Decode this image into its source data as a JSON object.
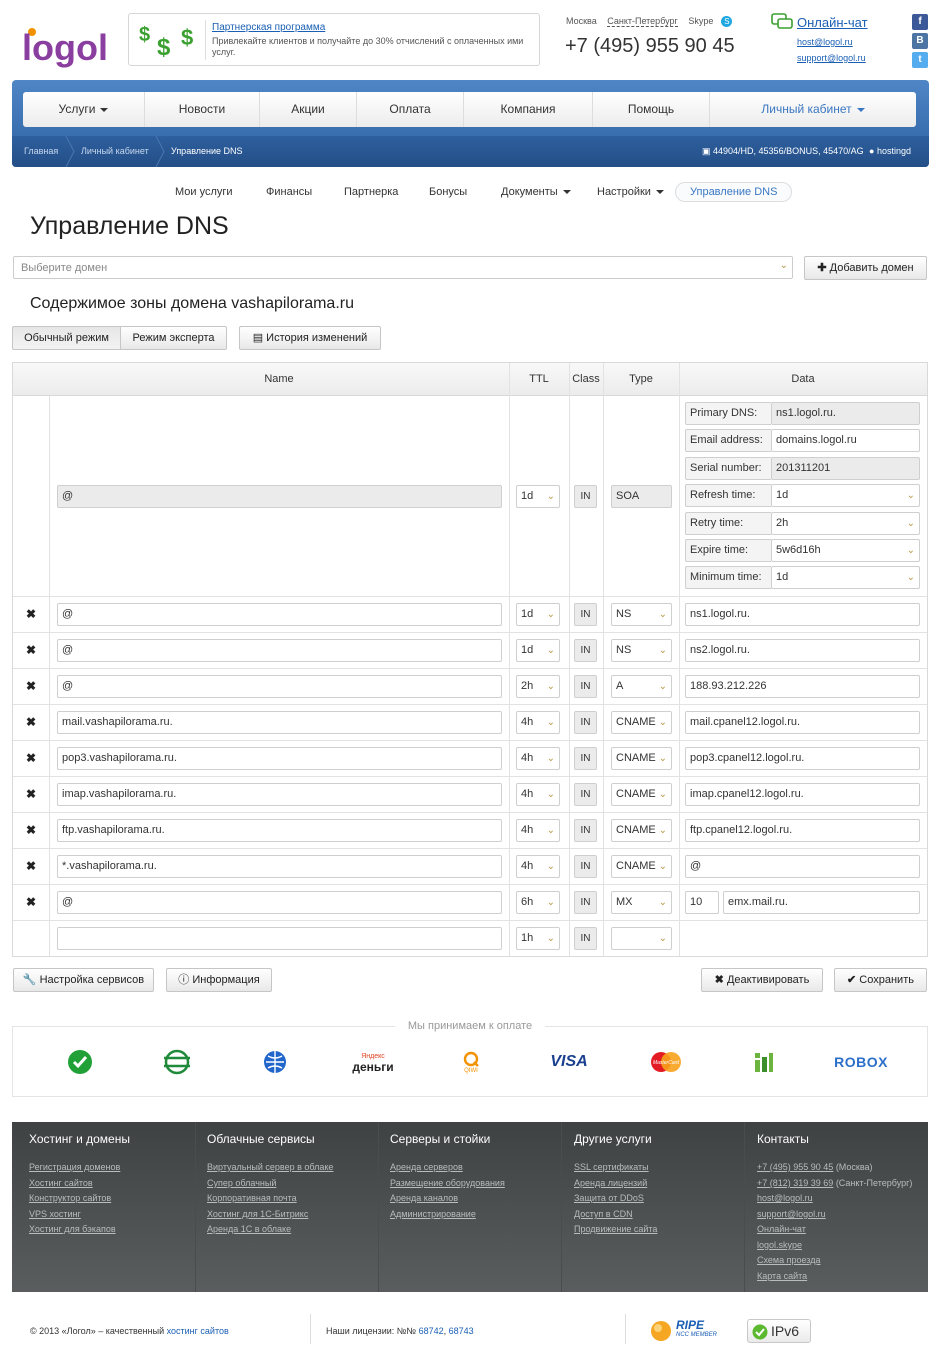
{
  "brand": {
    "logo_text": "logol"
  },
  "partner": {
    "title": "Партнерская программа",
    "text": "Привлекайте клиентов и получайте до 30% отчислений с оплаченных ими услуг."
  },
  "contacts": {
    "city_moscow": "Москва",
    "city_spb": "Санкт-Петербург",
    "skype": "Skype",
    "phone": "+7 (495) 955 90 45",
    "chat": "Онлайн-чат",
    "email1": "host@logol.ru",
    "email2": "support@logol.ru"
  },
  "social": {
    "facebook": "f",
    "vk": "В",
    "twitter": "t"
  },
  "nav": {
    "items": [
      {
        "label": "Услуги"
      },
      {
        "label": "Новости"
      },
      {
        "label": "Акции"
      },
      {
        "label": "Оплата"
      },
      {
        "label": "Компания"
      },
      {
        "label": "Помощь"
      },
      {
        "label": "Личный кабинет"
      }
    ]
  },
  "breadcrumb": {
    "home": "Главная",
    "cabinet": "Личный кабинет",
    "current": "Управление DNS",
    "accounts": "44904/HD, 45356/BONUS, 45470/AG",
    "user": "hostingd"
  },
  "subnav": {
    "items": [
      {
        "label": "Мои услуги"
      },
      {
        "label": "Финансы"
      },
      {
        "label": "Партнерка"
      },
      {
        "label": "Бонусы"
      },
      {
        "label": "Документы"
      },
      {
        "label": "Настройки"
      },
      {
        "label": "Управление DNS"
      }
    ]
  },
  "page": {
    "title": "Управление DNS"
  },
  "domain": {
    "placeholder": "Выберите домен",
    "add_button": "Добавить домен",
    "zone_title": "Содержимое зоны домена vashapilorama.ru"
  },
  "modes": {
    "normal": "Обычный режим",
    "expert": "Режим эксперта",
    "history": "История изменений"
  },
  "table": {
    "headers": {
      "name": "Name",
      "ttl": "TTL",
      "class": "Class",
      "type": "Type",
      "data": "Data"
    },
    "soa": {
      "name": "@",
      "ttl": "1d",
      "class": "IN",
      "type": "SOA",
      "fields": [
        {
          "label": "Primary DNS:",
          "value": "ns1.logol.ru."
        },
        {
          "label": "Email address:",
          "value": "domains.logol.ru"
        },
        {
          "label": "Serial number:",
          "value": "201311201"
        },
        {
          "label": "Refresh time:",
          "value": "1d"
        },
        {
          "label": "Retry time:",
          "value": "2h"
        },
        {
          "label": "Expire time:",
          "value": "5w6d16h"
        },
        {
          "label": "Minimum time:",
          "value": "1d"
        }
      ]
    },
    "rows": [
      {
        "name": "@",
        "ttl": "1d",
        "class": "IN",
        "type": "NS",
        "data": "ns1.logol.ru."
      },
      {
        "name": "@",
        "ttl": "1d",
        "class": "IN",
        "type": "NS",
        "data": "ns2.logol.ru."
      },
      {
        "name": "@",
        "ttl": "2h",
        "class": "IN",
        "type": "A",
        "data": "188.93.212.226"
      },
      {
        "name": "mail.vashapilorama.ru.",
        "ttl": "4h",
        "class": "IN",
        "type": "CNAME",
        "data": "mail.cpanel12.logol.ru."
      },
      {
        "name": "pop3.vashapilorama.ru.",
        "ttl": "4h",
        "class": "IN",
        "type": "CNAME",
        "data": "pop3.cpanel12.logol.ru."
      },
      {
        "name": "imap.vashapilorama.ru.",
        "ttl": "4h",
        "class": "IN",
        "type": "CNAME",
        "data": "imap.cpanel12.logol.ru."
      },
      {
        "name": "ftp.vashapilorama.ru.",
        "ttl": "4h",
        "class": "IN",
        "type": "CNAME",
        "data": "ftp.cpanel12.logol.ru."
      },
      {
        "name": "*.vashapilorama.ru.",
        "ttl": "4h",
        "class": "IN",
        "type": "CNAME",
        "data": "@"
      },
      {
        "name": "@",
        "ttl": "6h",
        "class": "IN",
        "type": "MX",
        "priority": "10",
        "data": "emx.mail.ru."
      }
    ],
    "new_row": {
      "name": "",
      "ttl": "1h",
      "class": "IN",
      "type": ""
    }
  },
  "actions": {
    "settings": "Настройка сервисов",
    "info": "Информация",
    "deactivate": "Деактивировать",
    "save": "Сохранить"
  },
  "payments": {
    "title": "Мы принимаем к оплате",
    "yandex": "деньги",
    "yandex_top": "Яндекс",
    "qiwi": "QIWI",
    "visa": "VISA",
    "mastercard": "MasterCard",
    "robox": "ROBOX"
  },
  "footer": {
    "columns": [
      {
        "title": "Хостинг и домены",
        "links": [
          "Регистрация доменов",
          "Хостинг сайтов",
          "Конструктор сайтов",
          "VPS хостинг",
          "Хостинг для бэкапов"
        ]
      },
      {
        "title": "Облачные сервисы",
        "links": [
          "Виртуальный сервер в облаке",
          "Супер облачный",
          "Корпоративная почта",
          "Хостинг для 1С-Битрикс",
          "Аренда 1С в облаке"
        ]
      },
      {
        "title": "Серверы и стойки",
        "links": [
          "Аренда серверов",
          "Размещение оборудования",
          "Аренда каналов",
          "Администрирование"
        ]
      },
      {
        "title": "Другие услуги",
        "links": [
          "SSL сертификаты",
          "Аренда лицензий",
          "Защита от DDoS",
          "Доступ в CDN",
          "Продвижение сайта"
        ]
      },
      {
        "title": "Контакты",
        "links": [
          "+7 (495) 955 90 45",
          "+7 (812) 319 39 69",
          "host@logol.ru",
          "support@logol.ru",
          "Онлайн-чат",
          "logol.skype",
          "Схема проезда",
          "Карта сайта"
        ]
      }
    ],
    "contact_notes": {
      "moscow": " (Москва)",
      "spb": " (Санкт-Петербург)"
    },
    "copyright": "© 2013 «Логол» – качественный ",
    "copyright_link": "хостинг сайтов",
    "licenses": "Наши лицензии: №№ ",
    "license1": "68742",
    "license2": "68743",
    "ripe": "RIPE",
    "ripe_sub": "NCC MEMBER",
    "ipv6": "IPv6"
  },
  "colors": {
    "brand_blue": "#3a6fb0",
    "link_blue": "#1a5fb4",
    "footer_dark": "#3f4243"
  }
}
